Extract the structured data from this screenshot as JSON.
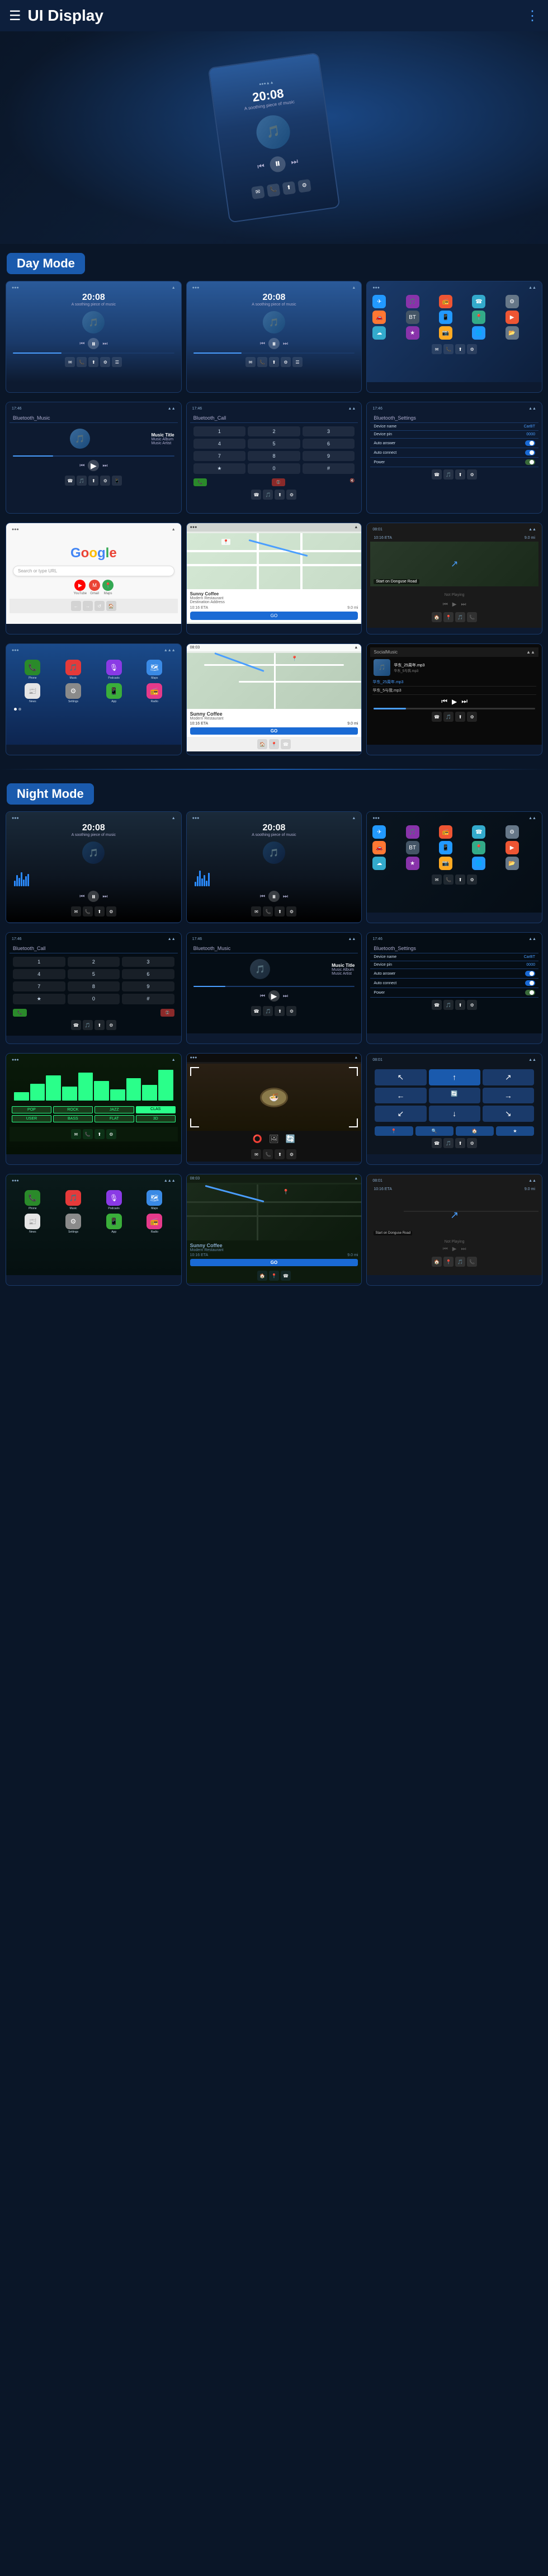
{
  "header": {
    "title": "UI Display",
    "menu_label": "≡",
    "dots_label": "⋮"
  },
  "sections": {
    "day_mode": "Day Mode",
    "night_mode": "Night Mode"
  },
  "music": {
    "time": "20:08",
    "subtitle": "A soothing piece of music",
    "title": "Music Title",
    "album": "Music Album",
    "artist": "Music Artist"
  },
  "bluetooth": {
    "music_label": "Bluetooth_Music",
    "call_label": "Bluetooth_Call",
    "settings_label": "Bluetooth_Settings"
  },
  "settings": {
    "device_name_label": "Device name",
    "device_name_val": "CarBT",
    "device_pin_label": "Device pin",
    "device_pin_val": "0000",
    "auto_answer_label": "Auto answer",
    "auto_connect_label": "Auto connect",
    "power_label": "Power"
  },
  "keypad": {
    "keys": [
      "1",
      "2•",
      "3•",
      "4•",
      "5•",
      "6•",
      "7•",
      "8•",
      "9•",
      "★",
      "0+",
      "#"
    ]
  },
  "google": {
    "logo": "Google",
    "search_placeholder": "Search or type URL"
  },
  "map": {
    "restaurant": "Sunny Coffee",
    "destination": "Modern Restaurant",
    "address": "Destination Address",
    "eta_label": "10:16 ETA",
    "distance": "9.0 mi",
    "go_label": "GO",
    "start_label": "Start on Donguse Road",
    "not_playing": "Not Playing"
  },
  "carplay_songs": [
    "华东_25周年.mp3",
    "华东_5与我.mp3"
  ],
  "colors": {
    "accent": "#1a5aad",
    "bg_dark": "#0a1628",
    "card_bg": "#0d1a30",
    "blue": "#4a9eff",
    "night_green": "#2aff8a"
  }
}
